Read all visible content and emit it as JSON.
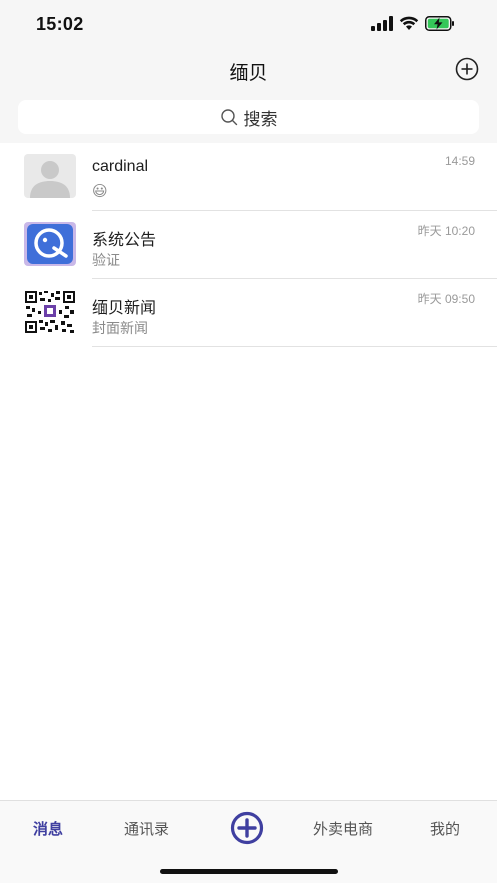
{
  "status_bar": {
    "time": "15:02"
  },
  "header": {
    "title": "缅贝"
  },
  "search": {
    "placeholder": "搜索"
  },
  "conversations": [
    {
      "name": "cardinal",
      "preview": "😃",
      "time": "14:59",
      "avatar": "default-user-avatar"
    },
    {
      "name": "系统公告",
      "preview": "验证",
      "time": "昨天 10:20",
      "avatar": "app-logo-avatar"
    },
    {
      "name": "缅贝新闻",
      "preview": "封面新闻",
      "time": "昨天 09:50",
      "avatar": "qr-code-avatar"
    }
  ],
  "tab_bar": {
    "messages": "消息",
    "contacts": "通讯录",
    "takeout": "外卖电商",
    "me": "我的"
  },
  "colors": {
    "accent": "#3f3fa0",
    "background": "#f6f6f6",
    "logo_blue": "#3f6fd9",
    "logo_bg": "#c9b8e8"
  }
}
